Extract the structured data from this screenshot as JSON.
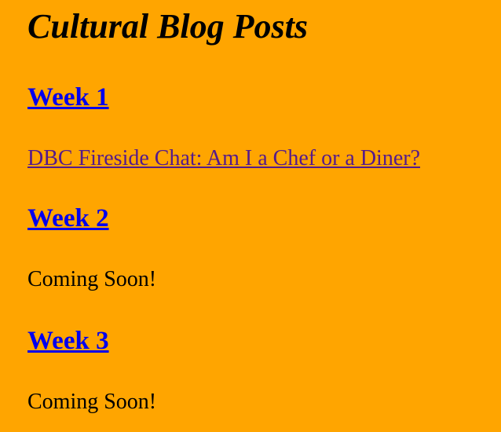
{
  "page": {
    "title": "Cultural Blog Posts",
    "background_color": "#FFA500",
    "link_color": "#0000EE",
    "visited_link_color": "#551A8B"
  },
  "weeks": [
    {
      "heading": "Week 1",
      "post_link": "DBC Fireside Chat: Am I a Chef or a Diner?"
    },
    {
      "heading": "Week 2",
      "status": "Coming Soon!"
    },
    {
      "heading": "Week 3",
      "status": "Coming Soon!"
    }
  ]
}
